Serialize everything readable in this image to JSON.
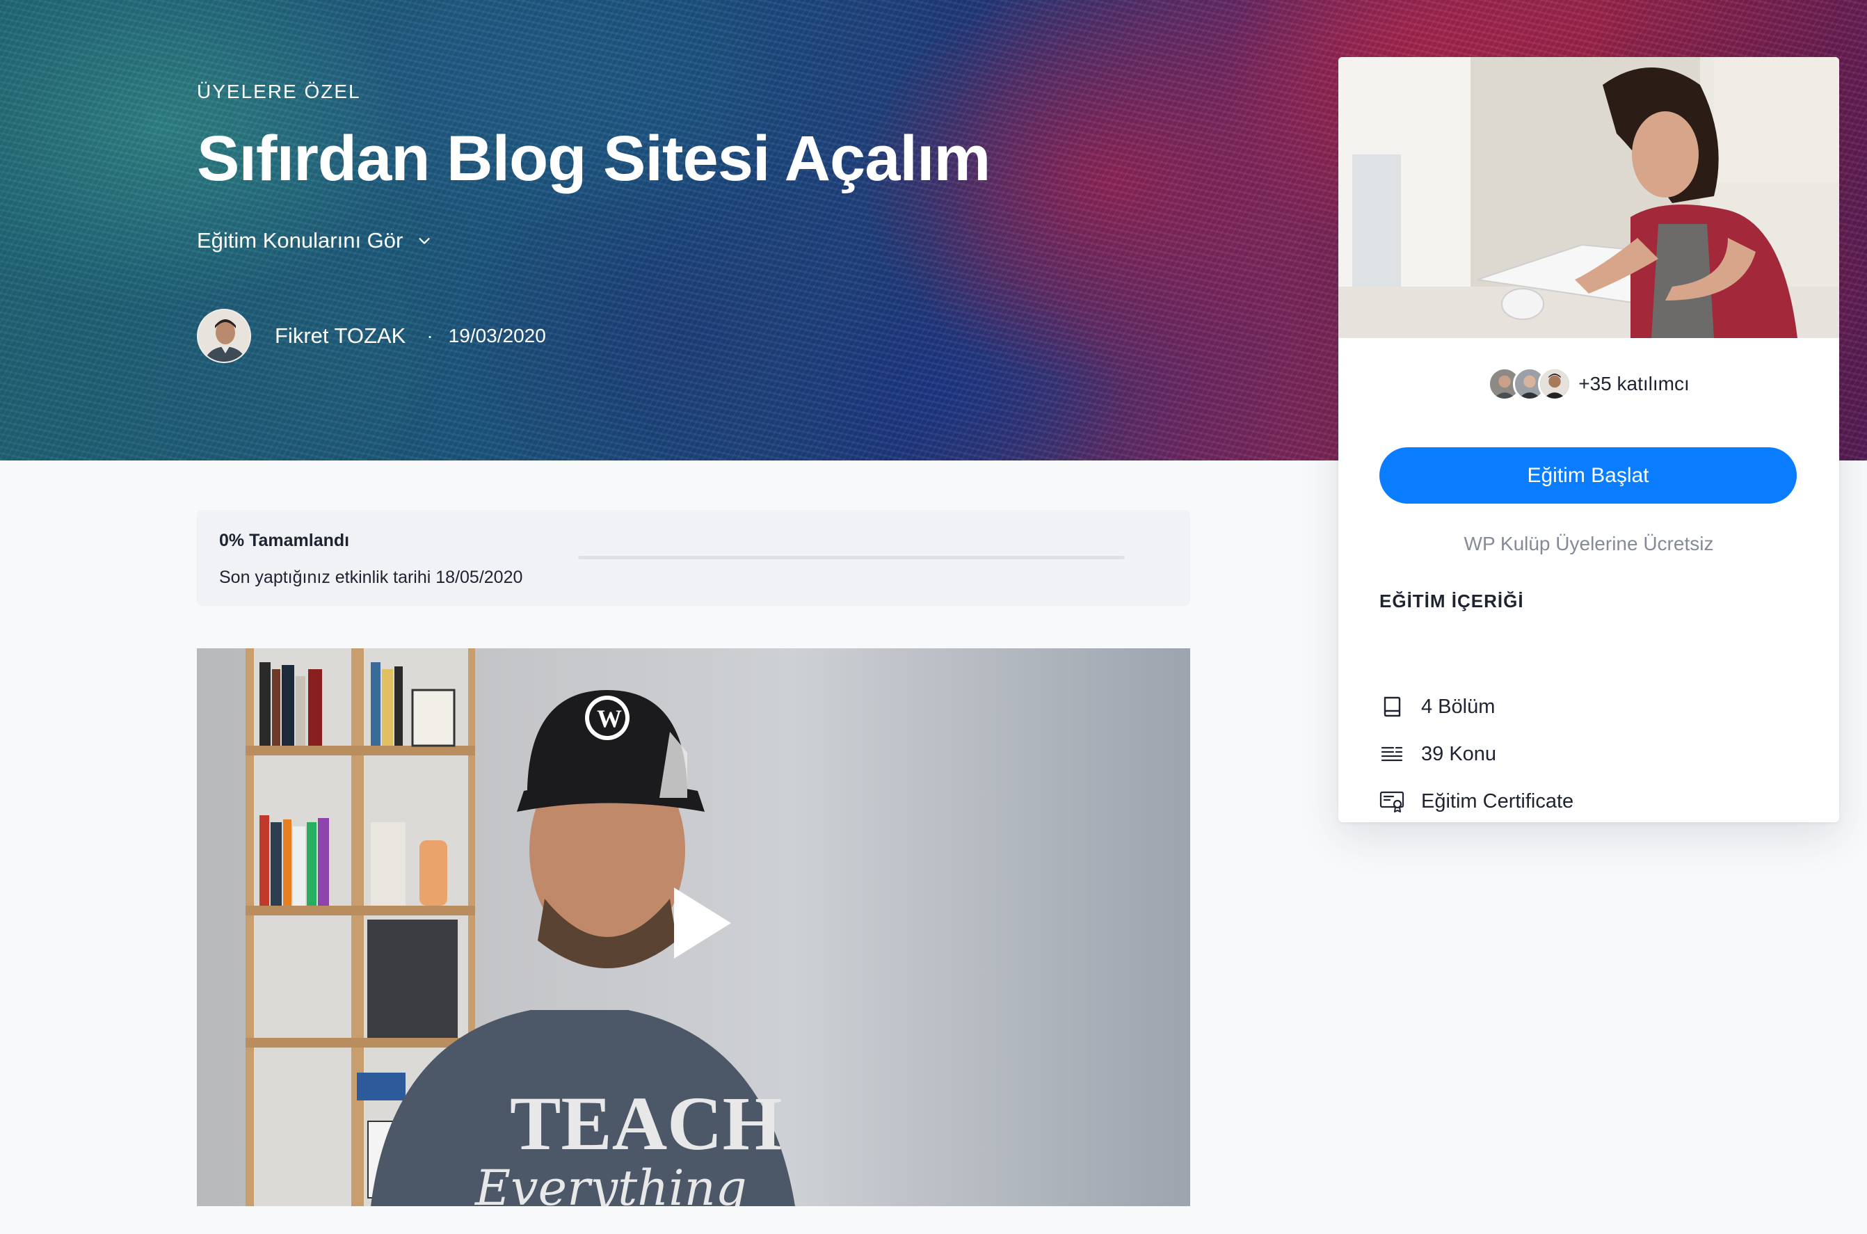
{
  "hero": {
    "eyebrow": "ÜYELERE ÖZEL",
    "title": "Sıfırdan Blog Sitesi Açalım",
    "topics_link": "Eğitim Konularını Gör",
    "author": {
      "name": "Fikret TOZAK",
      "separator": "·",
      "date": "19/03/2020"
    }
  },
  "progress": {
    "percent_label": "0% Tamamlandı",
    "last_activity": "Son yaptığınız etkinlik tarihi 18/05/2020",
    "value": 0
  },
  "sidebar": {
    "participants": "+35 katılımcı",
    "start_button": "Eğitim Başlat",
    "free_note": "WP Kulüp Üyelerine Ücretsiz",
    "contents_heading": "EĞİTİM İÇERİĞİ",
    "contents": [
      {
        "icon": "book-icon",
        "label": "4 Bölüm"
      },
      {
        "icon": "lines-icon",
        "label": "39 Konu"
      },
      {
        "icon": "certificate-icon",
        "label": "Eğitim Certificate"
      }
    ]
  },
  "colors": {
    "accent": "#0a7cff",
    "text": "#1d2330",
    "muted": "#858b96",
    "page_bg": "#f8f9fb"
  }
}
